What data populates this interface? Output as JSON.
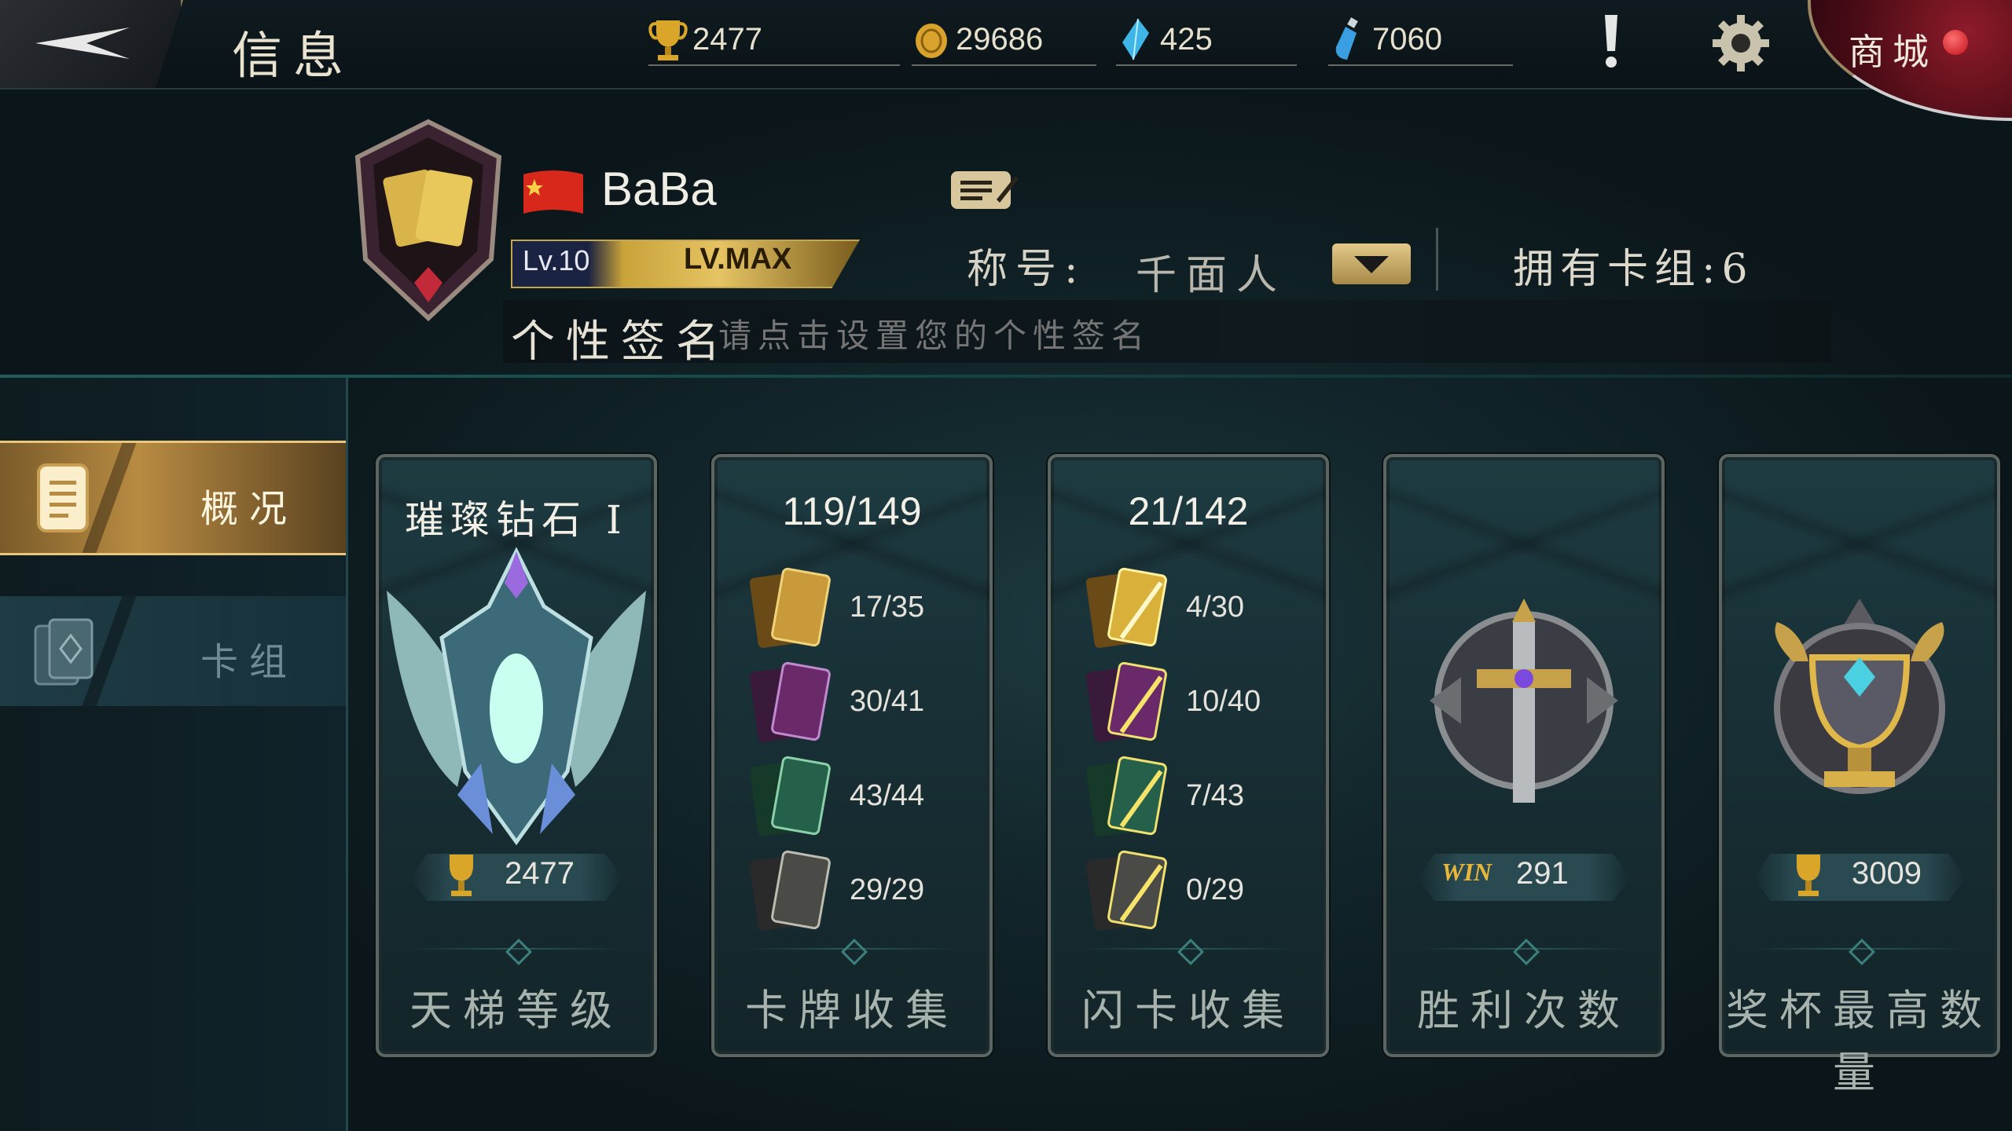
{
  "header": {
    "title": "信息",
    "resources": [
      {
        "name": "trophy-icon",
        "value": "2477"
      },
      {
        "name": "gold-coin-icon",
        "value": "29686"
      },
      {
        "name": "blue-crystal-icon",
        "value": "425"
      },
      {
        "name": "potion-icon",
        "value": "7060"
      }
    ],
    "shop_label": "商城"
  },
  "profile": {
    "name": "BaBa",
    "level": "Lv.10",
    "level_max": "LV.MAX",
    "title_label": "称号:",
    "title_value": "千面人",
    "decks_owned": "拥有卡组:6",
    "signature_label": "个性签名",
    "signature_placeholder": "请点击设置您的个性签名"
  },
  "sidebar": {
    "tabs": [
      {
        "label": "概况",
        "active": true
      },
      {
        "label": "卡组",
        "active": false
      }
    ]
  },
  "cards": {
    "ladder": {
      "head": "璀璨钻石 I",
      "trophies": "2477",
      "foot": "天梯等级"
    },
    "collection": {
      "head": "119/149",
      "rows": [
        {
          "rarity": "legendary",
          "value": "17/35"
        },
        {
          "rarity": "epic",
          "value": "30/41"
        },
        {
          "rarity": "rare",
          "value": "43/44"
        },
        {
          "rarity": "common",
          "value": "29/29"
        }
      ],
      "foot": "卡牌收集"
    },
    "flash": {
      "head": "21/142",
      "rows": [
        {
          "rarity": "legendary",
          "value": "4/30"
        },
        {
          "rarity": "epic",
          "value": "10/40"
        },
        {
          "rarity": "rare",
          "value": "7/43"
        },
        {
          "rarity": "common",
          "value": "0/29"
        }
      ],
      "foot": "闪卡收集"
    },
    "wins": {
      "tag": "WIN",
      "value": "291",
      "foot": "胜利次数"
    },
    "max_trophies": {
      "value": "3009",
      "foot": "奖杯最高数量"
    }
  },
  "colors": {
    "accent_gold": "#c9a33a",
    "teal_bg": "#183036",
    "shop_red": "#8e1b2a"
  }
}
